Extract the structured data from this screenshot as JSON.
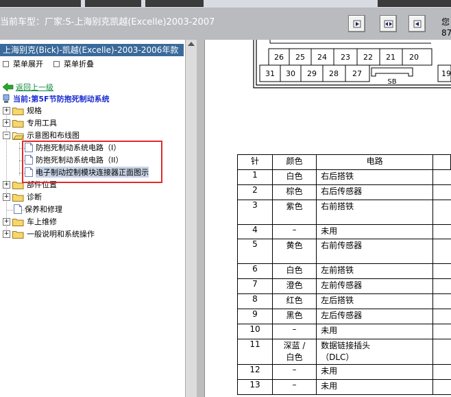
{
  "header": {
    "model_text": "当前车型：厂家:S-上海别克凯越(Excelle)2003-2007",
    "user_text": "您",
    "user_text2": "87"
  },
  "toolbar": {
    "buttons": [
      "expand-right-button",
      "compare-button",
      "collapse-left-button"
    ]
  },
  "left": {
    "vehicle_header": "上海别克(Bick)-凯越(Excelle)-2003-2006年款",
    "expand_all": "菜单展开",
    "collapse_all": "菜单折叠",
    "back": "返回上一级",
    "current": "当前:第5F节防抱死制动系统",
    "tree": [
      {
        "label": "规格",
        "type": "folder"
      },
      {
        "label": "专用工具",
        "type": "folder"
      },
      {
        "label": "示意图和布线图",
        "type": "folder-open"
      },
      {
        "label": "防抱死制动系统电路（I）",
        "type": "doc"
      },
      {
        "label": "防抱死制动系统电路（II）",
        "type": "doc"
      },
      {
        "label": "电子制动控制模块连接器正面图示",
        "type": "doc"
      },
      {
        "label": "部件位置",
        "type": "folder"
      },
      {
        "label": "诊断",
        "type": "folder"
      },
      {
        "label": "保养和修理",
        "type": "doc"
      },
      {
        "label": "车上维修",
        "type": "folder"
      },
      {
        "label": "一般说明和系统操作",
        "type": "folder"
      }
    ]
  },
  "connector": {
    "top_row": [
      "26",
      "25",
      "24",
      "23",
      "22",
      "21",
      "20"
    ],
    "bottom_row": [
      "31",
      "30",
      "29",
      "28",
      "27"
    ],
    "latch": "SB",
    "edge_pin": "19"
  },
  "pin_table": {
    "headers": [
      "针",
      "颜色",
      "电路"
    ],
    "rows": [
      {
        "pin": "1",
        "color": "白色",
        "circuit": "右后搭铁"
      },
      {
        "pin": "2",
        "color": "棕色",
        "circuit": "右后传感器"
      },
      {
        "pin": "3",
        "color": "紫色",
        "circuit": "右前搭铁"
      },
      {
        "pin": "4",
        "color": "–",
        "circuit": "未用"
      },
      {
        "pin": "5",
        "color": "黄色",
        "circuit": "右前传感器"
      },
      {
        "pin": "6",
        "color": "白色",
        "circuit": "左前搭铁"
      },
      {
        "pin": "7",
        "color": "澄色",
        "circuit": "左前传感器"
      },
      {
        "pin": "8",
        "color": "红色",
        "circuit": "左后搭铁"
      },
      {
        "pin": "9",
        "color": "黑色",
        "circuit": "左后传感器"
      },
      {
        "pin": "10",
        "color": "–",
        "circuit": "未用"
      },
      {
        "pin": "11",
        "color": "深蓝 /",
        "color2": "白色",
        "circuit": "数据链接插头",
        "circuit2": "（DLC）"
      },
      {
        "pin": "12",
        "color": "–",
        "circuit": "未用"
      },
      {
        "pin": "13",
        "color": "–",
        "circuit": "未用"
      }
    ]
  },
  "colors": {
    "toolbar_bg": "#b9bbbf",
    "header_blue": "#3a6a9a",
    "highlight_red": "#e02a2a",
    "link_green": "#0b8a3a",
    "current_blue": "#1a2bd0"
  }
}
